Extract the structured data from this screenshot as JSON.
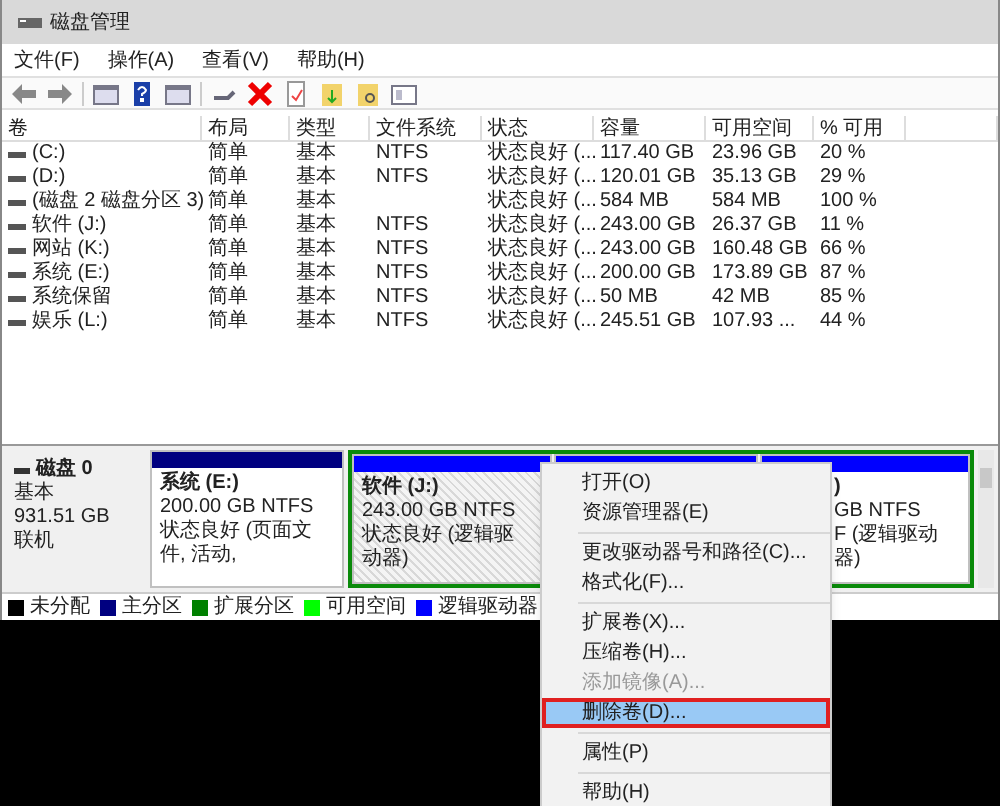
{
  "window": {
    "title": "磁盘管理"
  },
  "menu": [
    "文件(F)",
    "操作(A)",
    "查看(V)",
    "帮助(H)"
  ],
  "table": {
    "columns": [
      "卷",
      "布局",
      "类型",
      "文件系统",
      "状态",
      "容量",
      "可用空间",
      "% 可用"
    ],
    "rows": [
      {
        "cells": [
          "(C:)",
          "简单",
          "基本",
          "NTFS",
          "状态良好 (...",
          "117.40 GB",
          "23.96 GB",
          "20 %"
        ]
      },
      {
        "cells": [
          "(D:)",
          "简单",
          "基本",
          "NTFS",
          "状态良好 (...",
          "120.01 GB",
          "35.13 GB",
          "29 %"
        ]
      },
      {
        "cells": [
          "(磁盘 2 磁盘分区 3)",
          "简单",
          "基本",
          "",
          "状态良好 (...",
          "584 MB",
          "584 MB",
          "100 %"
        ]
      },
      {
        "cells": [
          "软件 (J:)",
          "简单",
          "基本",
          "NTFS",
          "状态良好 (...",
          "243.00 GB",
          "26.37 GB",
          "11 %"
        ]
      },
      {
        "cells": [
          "网站 (K:)",
          "简单",
          "基本",
          "NTFS",
          "状态良好 (...",
          "243.00 GB",
          "160.48 GB",
          "66 %"
        ]
      },
      {
        "cells": [
          "系统 (E:)",
          "简单",
          "基本",
          "NTFS",
          "状态良好 (...",
          "200.00 GB",
          "173.89 GB",
          "87 %"
        ]
      },
      {
        "cells": [
          "系统保留",
          "简单",
          "基本",
          "NTFS",
          "状态良好 (...",
          "50 MB",
          "42 MB",
          "85 %"
        ]
      },
      {
        "cells": [
          "娱乐 (L:)",
          "简单",
          "基本",
          "NTFS",
          "状态良好 (...",
          "245.51 GB",
          "107.93 ...",
          "44 %"
        ]
      }
    ]
  },
  "disk": {
    "name": "磁盘 0",
    "type": "基本",
    "size": "931.51 GB",
    "status": "联机",
    "partitions": [
      {
        "kind": "primary",
        "title": "系统 (E:)",
        "size": "200.00 GB NTFS",
        "status": "状态良好 (页面文件, 活动,",
        "selected": false
      },
      {
        "kind": "logical",
        "title": "软件 (J:)",
        "size": "243.00 GB NTFS",
        "status": "状态良好 (逻辑驱动器)",
        "selected": true
      },
      {
        "kind": "logical"
      },
      {
        "kind": "logical",
        "title": ")",
        "size": "GB NTFS",
        "status": "F (逻辑驱动器)",
        "selected": false
      }
    ]
  },
  "legend": [
    {
      "label": "未分配",
      "color": "#000000"
    },
    {
      "label": "主分区",
      "color": "#000080"
    },
    {
      "label": "扩展分区",
      "color": "#008000"
    },
    {
      "label": "可用空间",
      "color": "#00ff00"
    },
    {
      "label": "逻辑驱动器",
      "color": "#0000ff"
    }
  ],
  "context_menu": [
    {
      "label": "打开(O)",
      "disabled": false,
      "selected": false,
      "separator_before": false
    },
    {
      "label": "资源管理器(E)",
      "disabled": false,
      "selected": false,
      "separator_before": false
    },
    {
      "label": "更改驱动器号和路径(C)...",
      "disabled": false,
      "selected": false,
      "separator_before": true
    },
    {
      "label": "格式化(F)...",
      "disabled": false,
      "selected": false,
      "separator_before": false
    },
    {
      "label": "扩展卷(X)...",
      "disabled": false,
      "selected": false,
      "separator_before": true
    },
    {
      "label": "压缩卷(H)...",
      "disabled": false,
      "selected": false,
      "separator_before": false
    },
    {
      "label": "添加镜像(A)...",
      "disabled": true,
      "selected": false,
      "separator_before": false
    },
    {
      "label": "删除卷(D)...",
      "disabled": false,
      "selected": true,
      "separator_before": false
    },
    {
      "label": "属性(P)",
      "disabled": false,
      "selected": false,
      "separator_before": true
    },
    {
      "label": "帮助(H)",
      "disabled": false,
      "selected": false,
      "separator_before": true
    }
  ]
}
